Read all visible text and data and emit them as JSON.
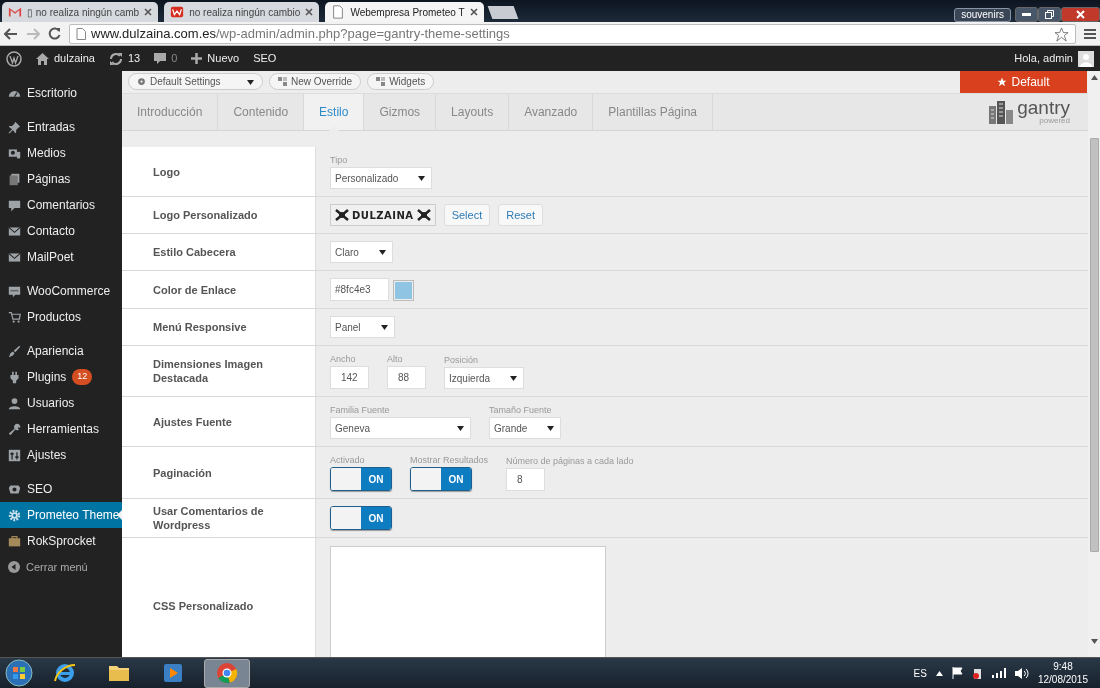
{
  "browser": {
    "tabs": [
      {
        "title": "▯ no realiza ningún camb",
        "selected": false
      },
      {
        "title": "no realiza ningún cambio",
        "selected": false
      },
      {
        "title": "Webempresa Prometeo T",
        "selected": true
      }
    ],
    "url": {
      "host": "www.dulzaina.com.es",
      "path": "/wp-admin/admin.php?page=gantry-theme-settings"
    },
    "profile": "souvenirs"
  },
  "admin_bar": {
    "site": "dulzaina",
    "updates": "13",
    "comments": "0",
    "new": "Nuevo",
    "seo": "SEO",
    "greeting": "Hola, admin"
  },
  "sidebar": {
    "groups": [
      [
        {
          "label": "Escritorio",
          "selected": false
        }
      ],
      [
        {
          "label": "Entradas",
          "selected": false
        },
        {
          "label": "Medios",
          "selected": false
        },
        {
          "label": "Páginas",
          "selected": false
        },
        {
          "label": "Comentarios",
          "selected": false
        },
        {
          "label": "Contacto",
          "selected": false
        },
        {
          "label": "MailPoet",
          "selected": false
        }
      ],
      [
        {
          "label": "WooCommerce",
          "selected": false
        },
        {
          "label": "Productos",
          "selected": false
        }
      ],
      [
        {
          "label": "Apariencia",
          "selected": false
        },
        {
          "label": "Plugins",
          "selected": false,
          "badge": "12"
        },
        {
          "label": "Usuarios",
          "selected": false
        },
        {
          "label": "Herramientas",
          "selected": false
        },
        {
          "label": "Ajustes",
          "selected": false
        }
      ],
      [
        {
          "label": "SEO",
          "selected": false
        },
        {
          "label": "Prometeo Theme",
          "selected": true
        },
        {
          "label": "RokSprocket",
          "selected": false
        }
      ]
    ],
    "collapse": "Cerrar menú"
  },
  "toolbar": {
    "preset": "Default Settings",
    "buttons": [
      "New Override",
      "Widgets"
    ],
    "preset_button": "Default"
  },
  "tabs": [
    {
      "label": "Introducción",
      "selected": false
    },
    {
      "label": "Contenido",
      "selected": false
    },
    {
      "label": "Estilo",
      "selected": true
    },
    {
      "label": "Gizmos",
      "selected": false
    },
    {
      "label": "Layouts",
      "selected": false
    },
    {
      "label": "Avanzado",
      "selected": false
    },
    {
      "label": "Plantillas Página",
      "selected": false
    }
  ],
  "brand": {
    "name": "gantry",
    "tagline": "powered"
  },
  "rows": [
    {
      "label": "Logo",
      "controls": [
        {
          "kind": "select",
          "caption": "Tipo",
          "value": "Personalizado"
        }
      ]
    },
    {
      "label": "Logo Personalizado",
      "controls": [
        {
          "kind": "image",
          "text": "DULZAINA"
        },
        {
          "kind": "button",
          "label": "Select"
        },
        {
          "kind": "button",
          "label": "Reset"
        }
      ]
    },
    {
      "label": "Estilo Cabecera",
      "controls": [
        {
          "kind": "select",
          "value": "Claro"
        }
      ]
    },
    {
      "label": "Color de Enlace",
      "controls": [
        {
          "kind": "color",
          "value": "#8fc4e3",
          "color": "#8fc4e3"
        }
      ]
    },
    {
      "label": "Menú Responsive",
      "controls": [
        {
          "kind": "select",
          "value": "Panel"
        }
      ]
    },
    {
      "label": "Dimensiones Imagen Destacada",
      "controls": [
        {
          "kind": "text",
          "caption": "Ancho",
          "value": "142"
        },
        {
          "kind": "text",
          "caption": "Alto",
          "value": "88"
        },
        {
          "kind": "select",
          "caption": "Posición",
          "value": "Izquierda"
        }
      ]
    },
    {
      "label": "Ajustes Fuente",
      "controls": [
        {
          "kind": "select",
          "caption": "Familia Fuente",
          "value": "Geneva"
        },
        {
          "kind": "select",
          "caption": "Tamaño Fuente",
          "value": "Grande"
        }
      ]
    },
    {
      "label": "Paginación",
      "controls": [
        {
          "kind": "toggle",
          "caption": "Activado",
          "on": true,
          "label": "ON"
        },
        {
          "kind": "toggle",
          "caption": "Mostrar Resultados",
          "on": true,
          "label": "ON"
        },
        {
          "kind": "text",
          "caption": "Número de páginas a cada lado",
          "value": "8"
        }
      ]
    },
    {
      "label": "Usar Comentarios de Wordpress",
      "controls": [
        {
          "kind": "toggle",
          "on": true,
          "label": "ON"
        }
      ]
    },
    {
      "label": "CSS Personalizado",
      "controls": [
        {
          "kind": "textarea"
        }
      ]
    }
  ],
  "taskbar": {
    "apps": [
      {
        "selected": false
      },
      {
        "selected": false
      },
      {
        "selected": false
      },
      {
        "selected": true
      }
    ],
    "language": "ES",
    "time": "9:48",
    "date": "12/08/2015"
  }
}
